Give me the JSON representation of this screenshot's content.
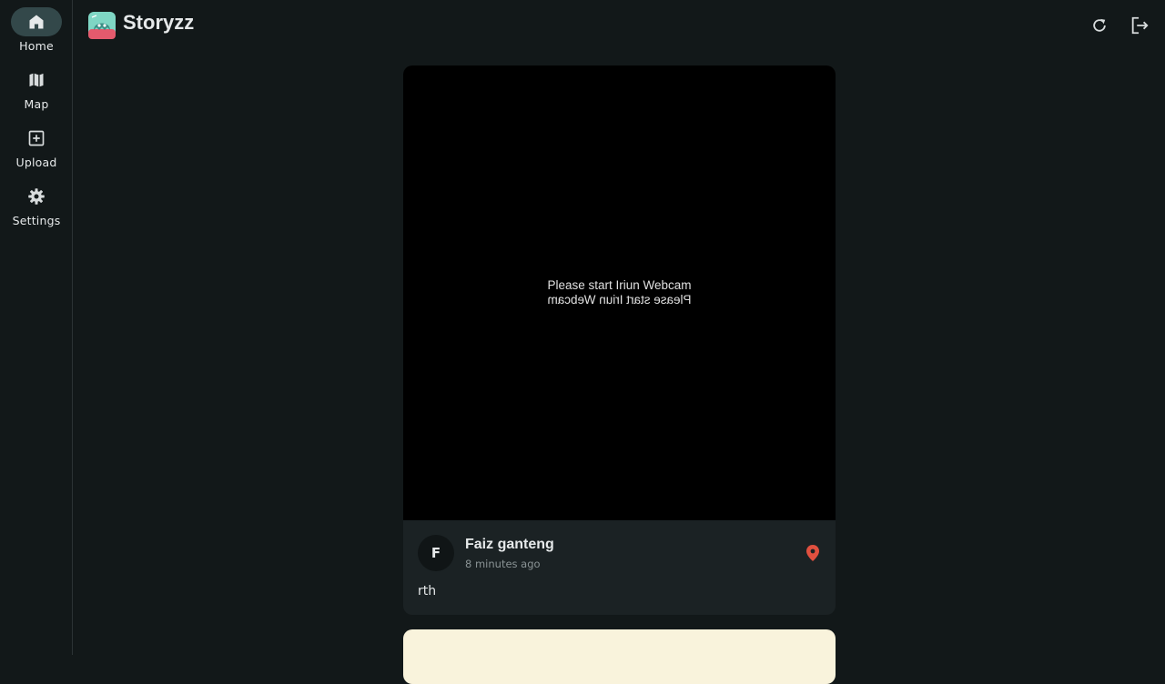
{
  "app": {
    "title": "Storyzz"
  },
  "nav": {
    "items": [
      {
        "label": "Home",
        "icon": "home-icon",
        "active": true
      },
      {
        "label": "Map",
        "icon": "map-icon",
        "active": false
      },
      {
        "label": "Upload",
        "icon": "add-box-icon",
        "active": false
      },
      {
        "label": "Settings",
        "icon": "gear-icon",
        "active": false
      }
    ]
  },
  "toolbar": {
    "refresh_icon": "refresh-icon",
    "logout_icon": "logout-icon"
  },
  "stories": [
    {
      "media_text": "Please start Iriun Webcam",
      "media_text_mirrored": "Please start Iriun Webcam",
      "author_initial": "F",
      "author": "Faiz ganteng",
      "time": "8 minutes ago",
      "description": "rth",
      "has_location": true
    }
  ],
  "colors": {
    "background": "#121819",
    "card": "#1b2224",
    "active_nav": "#33484a",
    "location_pin": "#e0503f",
    "next_card": "#f9f3dc"
  }
}
